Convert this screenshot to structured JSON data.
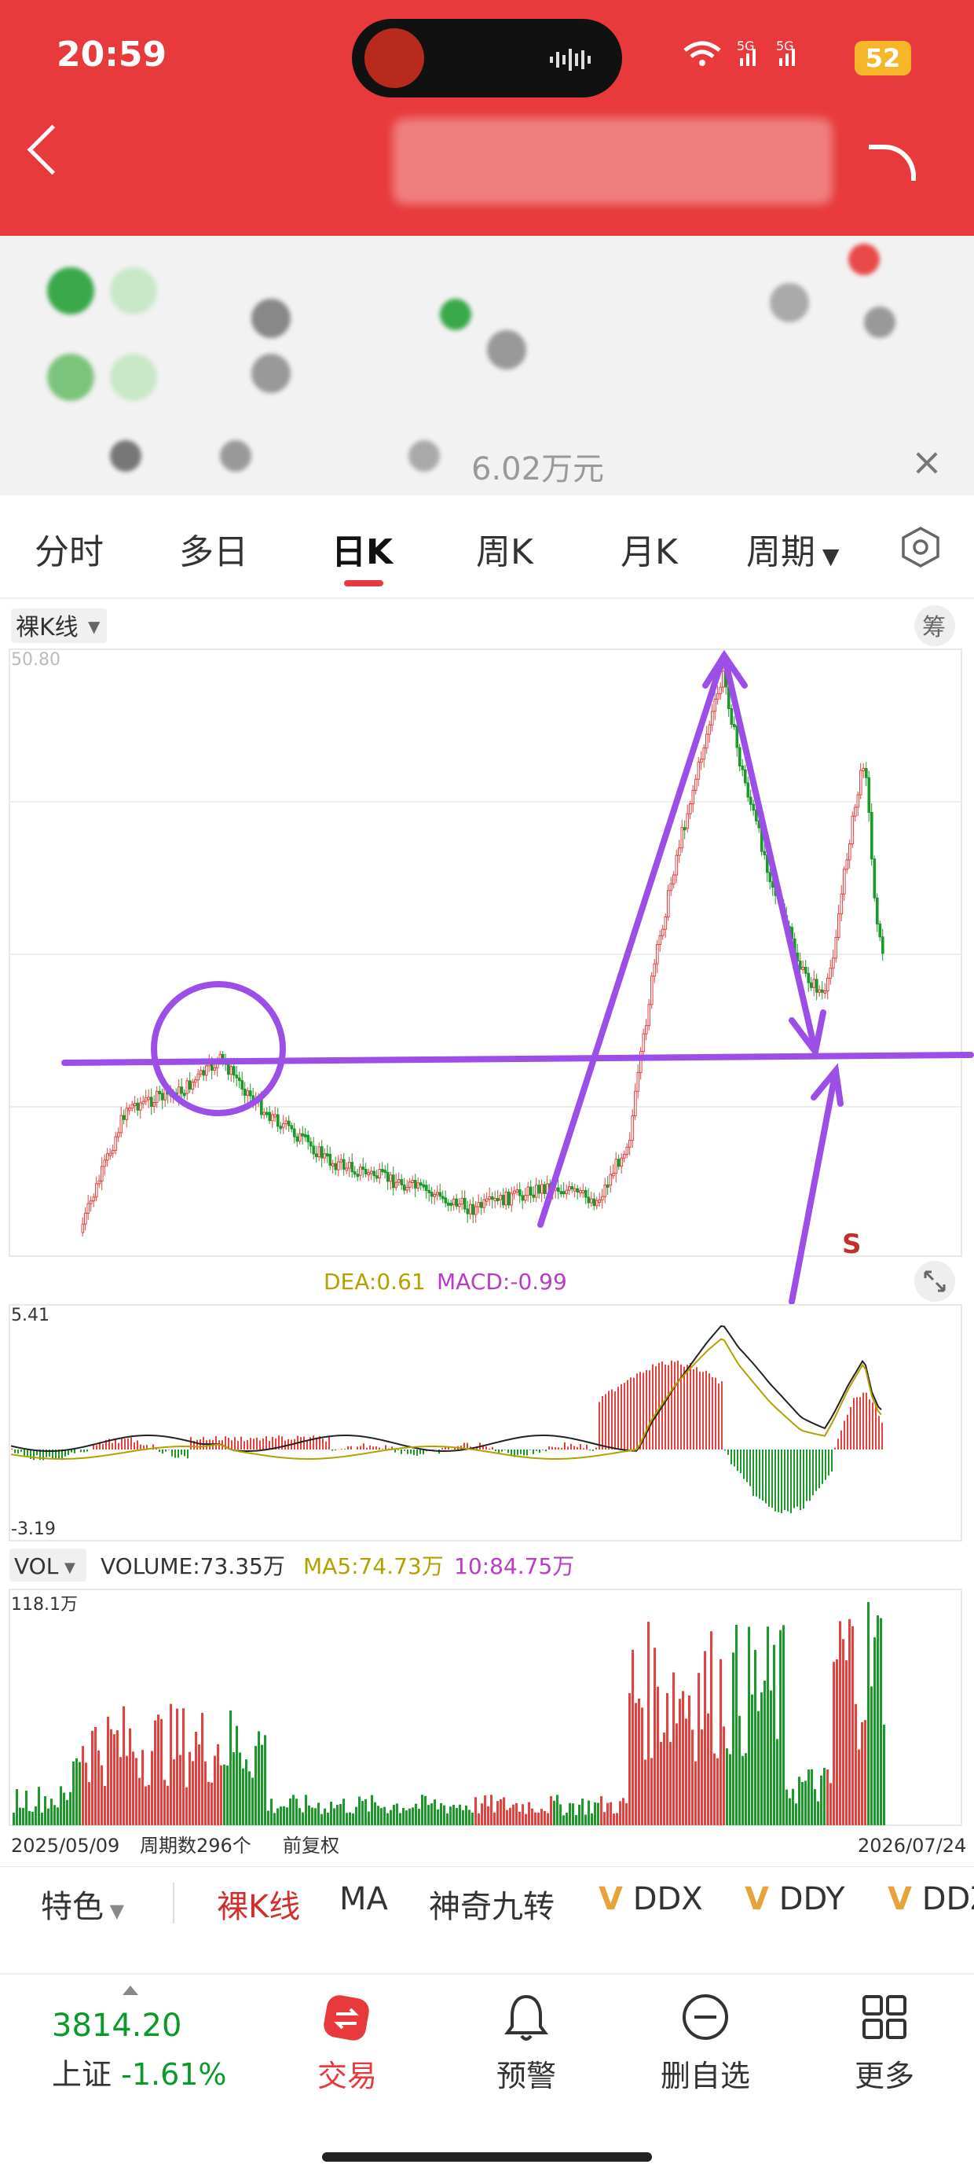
{
  "status_bar": {
    "time": "20:59",
    "network": "5G 5G",
    "battery": "52"
  },
  "quote": {
    "amount_fragment": "6.02万元"
  },
  "tabs": [
    "分时",
    "多日",
    "日K",
    "周K",
    "月K",
    "周期"
  ],
  "active_tab": "日K",
  "kline": {
    "type_selector": "裸K线",
    "chou_label": "筹",
    "top_price": "50.80",
    "annotation_s": "S"
  },
  "macd": {
    "dea_label": "DEA:0.61",
    "macd_label": "MACD:-0.99",
    "max": "5.41",
    "min": "-3.19"
  },
  "volume": {
    "selector": "VOL",
    "volume_label": "VOLUME:73.35万",
    "ma5_label": "MA5:74.73万",
    "ma10_label": "10:84.75万",
    "max": "118.1万",
    "start_date": "2025/05/09",
    "period_count": "周期数296个",
    "adjust": "前复权",
    "end_date": "2026/07/24"
  },
  "bottom_tools": {
    "feature": "特色",
    "kline": "裸K线",
    "ma": "MA",
    "nine": "神奇九转",
    "ddx": "DDX",
    "ddy": "DDY",
    "ddz": "DDZ"
  },
  "navbar": {
    "index_value": "3814.20",
    "index_name": "上证",
    "index_pct": "-1.61%",
    "trade": "交易",
    "alert": "预警",
    "remove": "删自选",
    "more": "更多"
  },
  "colors": {
    "up": "#e8403c",
    "down": "#1a9a28",
    "accent": "#e83a3c",
    "annotation": "#9b4fe6"
  },
  "chart_data": {
    "type": "candlestick",
    "x_start": "2025/05/09",
    "x_end": "2026/07/24",
    "periods": 296,
    "price_max": 50.8
  }
}
